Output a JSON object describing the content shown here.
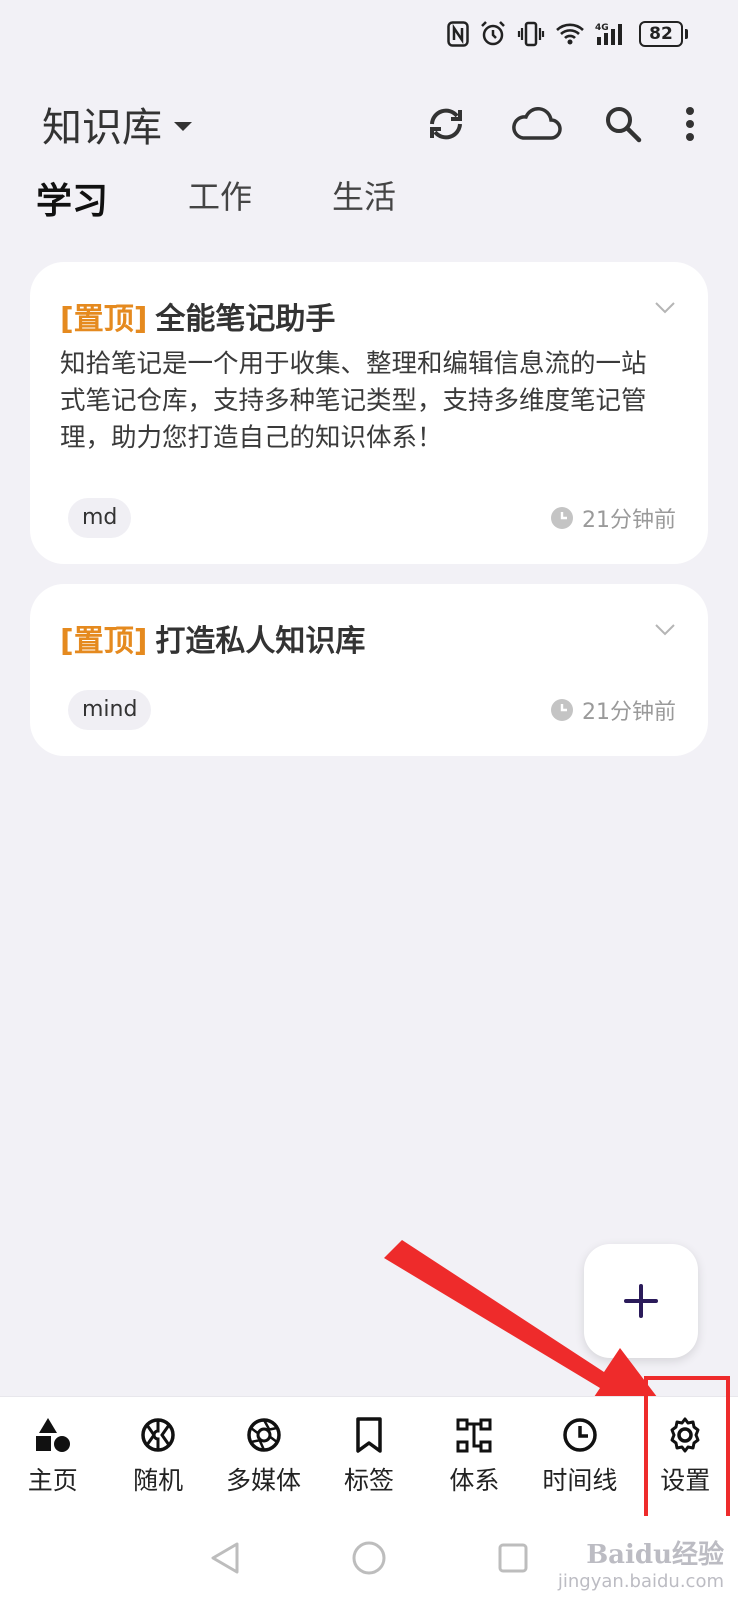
{
  "status": {
    "battery": "82"
  },
  "header": {
    "title": "知识库",
    "actions": [
      "sync-icon",
      "cloud-icon",
      "search-icon",
      "more-vertical-icon"
    ]
  },
  "tabs": [
    {
      "label": "学习",
      "active": true
    },
    {
      "label": "工作",
      "active": false
    },
    {
      "label": "生活",
      "active": false
    }
  ],
  "notes": [
    {
      "pin": "[置顶]",
      "title": "全能笔记助手",
      "body": "知拾笔记是一个用于收集、整理和编辑信息流的一站式笔记仓库，支持多种笔记类型，支持多维度笔记管理，助力您打造自己的知识体系！",
      "tag": "md",
      "time": "21分钟前"
    },
    {
      "pin": "[置顶]",
      "title": "打造私人知识库",
      "tag": "mind",
      "time": "21分钟前"
    }
  ],
  "fab": {
    "icon": "plus-icon"
  },
  "bottom_nav": [
    {
      "label": "主页",
      "icon": "shapes-icon"
    },
    {
      "label": "随机",
      "icon": "random-icon"
    },
    {
      "label": "多媒体",
      "icon": "aperture-icon"
    },
    {
      "label": "标签",
      "icon": "bookmark-icon"
    },
    {
      "label": "体系",
      "icon": "hierarchy-icon"
    },
    {
      "label": "时间线",
      "icon": "clock-icon"
    },
    {
      "label": "设置",
      "icon": "gear-icon"
    }
  ],
  "colors": {
    "pin": "#e58a1f",
    "accent": "#2b1b5a",
    "annotation": "#ee2b2b",
    "background": "#f2f1f6"
  },
  "watermark": {
    "main": "Baidu经验",
    "sub": "jingyan.baidu.com"
  }
}
